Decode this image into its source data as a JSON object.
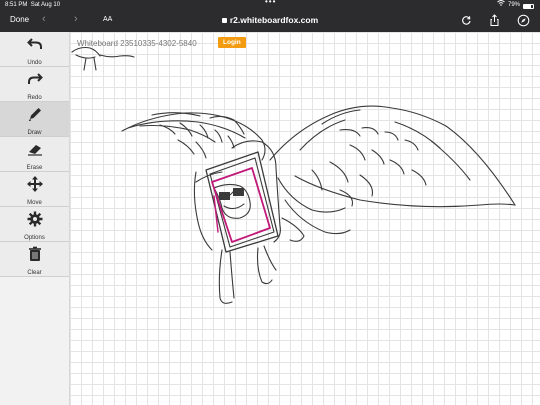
{
  "status_bar": {
    "time": "8:51 PM",
    "date": "Sat Aug 10",
    "dots": "•••",
    "battery": "79%"
  },
  "browser": {
    "done_label": "Done",
    "back_glyph": "‹",
    "forward_glyph": "›",
    "text_size_label": "AA",
    "url": "r2.whiteboardfox.com",
    "icons": [
      "lock-icon",
      "reload-icon",
      "share-icon",
      "compass-icon"
    ]
  },
  "board": {
    "id_text": "Whiteboard 23510335-4302-5840",
    "login_label": "Login",
    "login_color": "#f39c12"
  },
  "toolbar": {
    "items": [
      {
        "label": "Undo",
        "icon": "undo-icon"
      },
      {
        "label": "Redo",
        "icon": "redo-icon"
      },
      {
        "label": "Draw",
        "icon": "pencil-icon",
        "active": true
      },
      {
        "label": "Erase",
        "icon": "eraser-icon"
      },
      {
        "label": "Move",
        "icon": "move-icon"
      },
      {
        "label": "Options",
        "icon": "gear-icon"
      },
      {
        "label": "Clear",
        "icon": "trash-icon"
      }
    ]
  },
  "drawing": {
    "stroke_color": "#3a3a3a",
    "accent_color": "#c2187a"
  }
}
